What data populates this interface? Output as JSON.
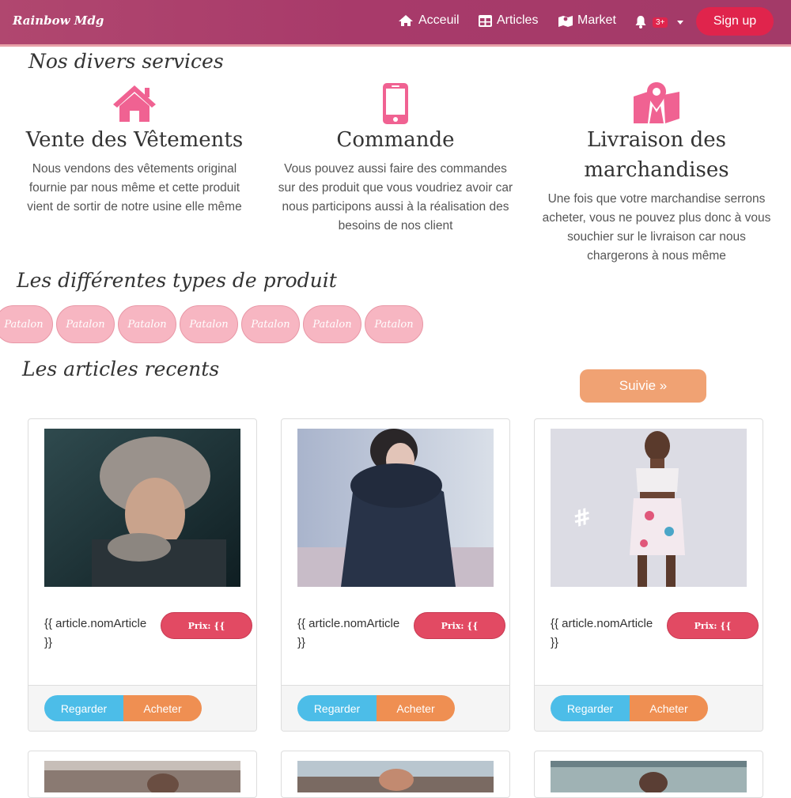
{
  "navbar": {
    "brand": "Rainbow Mdg",
    "items": [
      {
        "label": "Acceuil",
        "icon": "home-icon"
      },
      {
        "label": "Articles",
        "icon": "table-icon"
      },
      {
        "label": "Market",
        "icon": "map-icon"
      }
    ],
    "notifications": {
      "icon": "bell-icon",
      "badge": "3+"
    },
    "signup_label": "Sign up"
  },
  "services": {
    "title": "Nos divers services",
    "items": [
      {
        "icon": "home-icon",
        "title": "Vente des Vêtements",
        "text": "Nous vendons des vêtements original fournie par nous même et cette produit vient de sortir de notre usine elle même"
      },
      {
        "icon": "mobile-icon",
        "title": "Commande",
        "text": "Vous pouvez aussi faire des commandes sur des produit que vous voudriez avoir car nous participons aussi à la réalisation des besoins de nos client"
      },
      {
        "icon": "map-marker-icon",
        "title": "Livraison des marchandises",
        "text": "Une fois que votre marchandise serrons acheter, vous ne pouvez plus donc à vous souchier sur le livraison car nous chargerons à nous même"
      }
    ]
  },
  "types": {
    "title": "Les différentes types de produit",
    "pills": [
      "Patalon",
      "Patalon",
      "Patalon",
      "Patalon",
      "Patalon",
      "Patalon",
      "Patalon"
    ]
  },
  "articles": {
    "title": "Les articles recents",
    "next_label": "Suivie »",
    "cards": [
      {
        "name": "{{ article.nomArticle }}",
        "price": "Prix: {{",
        "view_label": "Regarder",
        "buy_label": "Acheter"
      },
      {
        "name": "{{ article.nomArticle }}",
        "price": "Prix: {{",
        "view_label": "Regarder",
        "buy_label": "Acheter"
      },
      {
        "name": "{{ article.nomArticle }}",
        "price": "Prix: {{",
        "view_label": "Regarder",
        "buy_label": "Acheter"
      }
    ]
  },
  "colors": {
    "accent": "#f06292",
    "navbar": "#a83a6a",
    "signup": "#e0244c",
    "view": "#4cbde8",
    "buy": "#ef8f52",
    "next": "#f0a273"
  }
}
